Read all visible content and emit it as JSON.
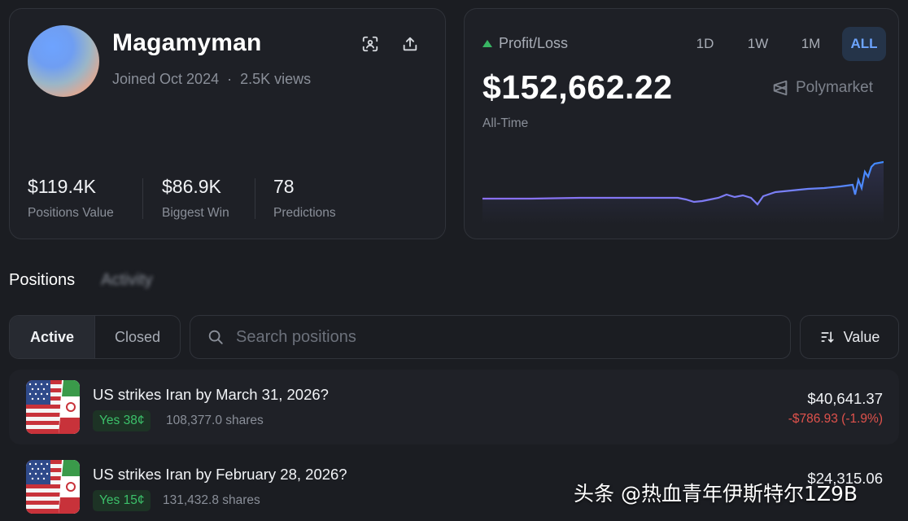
{
  "profile": {
    "username": "Magamyman",
    "joined": "Joined Oct 2024",
    "separator": "·",
    "views": "2.5K views",
    "stats": [
      {
        "value": "$119.4K",
        "label": "Positions Value"
      },
      {
        "value": "$86.9K",
        "label": "Biggest Win"
      },
      {
        "value": "78",
        "label": "Predictions"
      }
    ],
    "icons": {
      "scan": "qr-scan-icon",
      "share": "share-icon"
    }
  },
  "pnl": {
    "label": "Profit/Loss",
    "trend_color": "#39b563",
    "value": "$152,662.22",
    "period": "All-Time",
    "brand": "Polymarket",
    "ranges": [
      "1D",
      "1W",
      "1M",
      "ALL"
    ],
    "active_range": "ALL",
    "line_colors": [
      "#8a6ff0",
      "#3f8bff"
    ]
  },
  "sections": {
    "tabs": [
      "Positions",
      "Activity"
    ],
    "active": "Positions"
  },
  "filters": {
    "segments": [
      "Active",
      "Closed"
    ],
    "active_segment": "Active",
    "search_placeholder": "Search positions",
    "sort_label": "Value"
  },
  "positions": [
    {
      "title": "US strikes Iran by March 31, 2026?",
      "badge": "Yes 38¢",
      "shares": "108,377.0 shares",
      "value": "$40,641.37",
      "change": "-$786.93 (-1.9%)"
    },
    {
      "title": "US strikes Iran by February 28, 2026?",
      "badge": "Yes 15¢",
      "shares": "131,432.8 shares",
      "value": "$24,315.06",
      "change": ""
    }
  ],
  "watermark": "头条 @热血青年伊斯特尔1Z9B"
}
